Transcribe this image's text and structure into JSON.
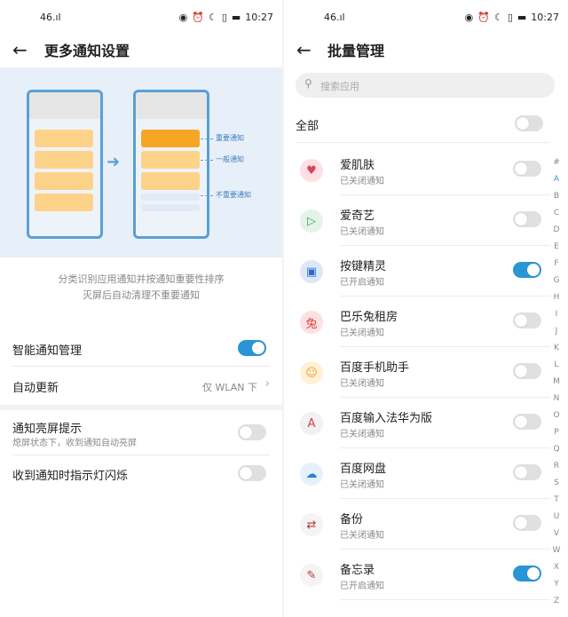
{
  "status": {
    "signal": "46.ıl",
    "time": "10:27"
  },
  "left": {
    "title": "更多通知设置",
    "illustration": {
      "tags": [
        "重要通知",
        "一般通知",
        "不重要通知"
      ]
    },
    "description": [
      "分类识别应用通知并按通知重要性排序",
      "灭屏后自动清理不重要通知"
    ],
    "settings": [
      {
        "label": "智能通知管理",
        "on": true
      },
      {
        "label": "自动更新",
        "value": "仅 WLAN 下"
      },
      {
        "label": "通知亮屏提示",
        "sub": "熄屏状态下，收到通知自动亮屏",
        "on": false
      },
      {
        "label": "收到通知时指示灯闪烁",
        "on": false
      }
    ]
  },
  "right": {
    "title": "批量管理",
    "search_placeholder": "搜索应用",
    "all_label": "全部",
    "apps": [
      {
        "name": "爱肌肤",
        "status": "已关闭通知",
        "on": false
      },
      {
        "name": "爱奇艺",
        "status": "已关闭通知",
        "on": false
      },
      {
        "name": "按键精灵",
        "status": "已开启通知",
        "on": true
      },
      {
        "name": "巴乐兔租房",
        "status": "已关闭通知",
        "on": false
      },
      {
        "name": "百度手机助手",
        "status": "已关闭通知",
        "on": false
      },
      {
        "name": "百度输入法华为版",
        "status": "已关闭通知",
        "on": false
      },
      {
        "name": "百度网盘",
        "status": "已关闭通知",
        "on": false
      },
      {
        "name": "备份",
        "status": "已关闭通知",
        "on": false
      },
      {
        "name": "备忘录",
        "status": "已开启通知",
        "on": true
      }
    ],
    "index": [
      "#",
      "A",
      "B",
      "C",
      "D",
      "E",
      "F",
      "G",
      "H",
      "I",
      "J",
      "K",
      "L",
      "M",
      "N",
      "O",
      "P",
      "Q",
      "R",
      "S",
      "T",
      "U",
      "V",
      "W",
      "X",
      "Y",
      "Z"
    ],
    "index_active": "A"
  },
  "colors": {
    "accent": "#2a95d6",
    "card": "#fdd289",
    "card_important": "#f5a623"
  }
}
